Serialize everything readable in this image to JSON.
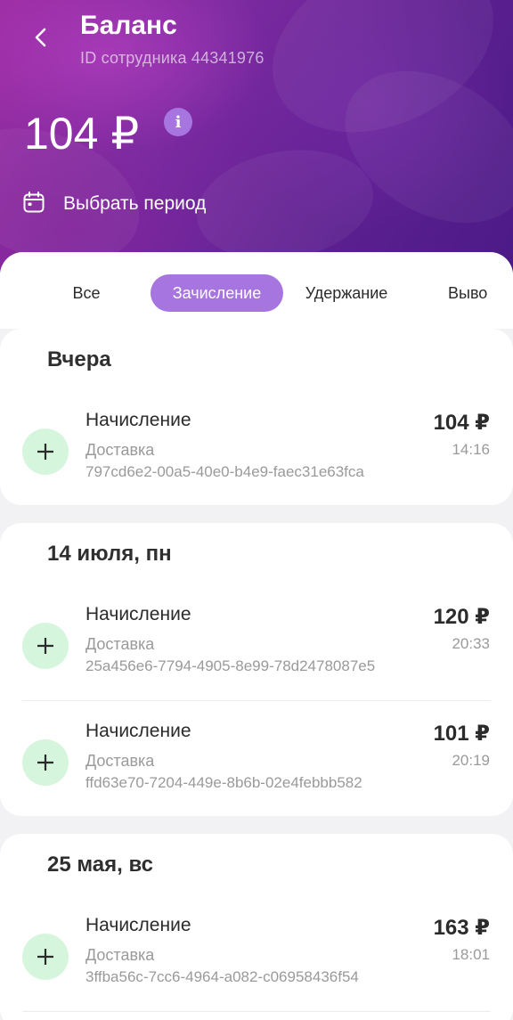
{
  "header": {
    "title": "Баланс",
    "subtitle": "ID сотрудника 44341976",
    "balance": "104 ₽",
    "info_label": "i",
    "period_label": "Выбрать период"
  },
  "tabs": [
    {
      "label": "Все",
      "active": false
    },
    {
      "label": "Зачисление",
      "active": true
    },
    {
      "label": "Удержание",
      "active": false
    },
    {
      "label": "Выво",
      "active": false
    }
  ],
  "groups": [
    {
      "date": "Вчера",
      "transactions": [
        {
          "name": "Начисление",
          "category": "Доставка",
          "id": "797cd6e2-00a5-40e0-b4e9-faec31e63fca",
          "amount": "104 ₽",
          "time": "14:16"
        }
      ]
    },
    {
      "date": "14 июля, пн",
      "transactions": [
        {
          "name": "Начисление",
          "category": "Доставка",
          "id": "25a456e6-7794-4905-8e99-78d2478087e5",
          "amount": "120 ₽",
          "time": "20:33"
        },
        {
          "name": "Начисление",
          "category": "Доставка",
          "id": "ffd63e70-7204-449e-8b6b-02e4febbb582",
          "amount": "101 ₽",
          "time": "20:19"
        }
      ]
    },
    {
      "date": "25 мая, вс",
      "transactions": [
        {
          "name": "Начисление",
          "category": "Доставка",
          "id": "3ffba56c-7cc6-4964-a082-c06958436f54",
          "amount": "163 ₽",
          "time": "18:01"
        }
      ]
    }
  ],
  "icons": {
    "back": "chevron-left-icon",
    "info": "info-icon",
    "calendar": "calendar-icon",
    "credit": "plus-icon"
  },
  "colors": {
    "header_gradient_start": "#9b2ca3",
    "header_gradient_end": "#4a1a86",
    "accent": "#a775e0",
    "credit_icon_bg": "#d5f5dc",
    "muted_text": "#9a9a9a"
  }
}
